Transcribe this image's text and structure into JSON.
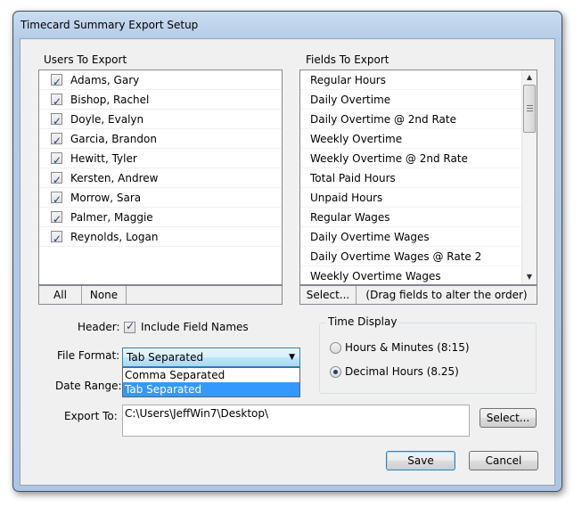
{
  "window": {
    "title": "Timecard Summary Export Setup"
  },
  "users": {
    "heading": "Users To Export",
    "items": [
      {
        "name": "Adams, Gary",
        "checked": true
      },
      {
        "name": "Bishop, Rachel",
        "checked": true
      },
      {
        "name": "Doyle, Evalyn",
        "checked": true
      },
      {
        "name": "Garcia, Brandon",
        "checked": true
      },
      {
        "name": "Hewitt, Tyler",
        "checked": true
      },
      {
        "name": "Kersten, Andrew",
        "checked": true
      },
      {
        "name": "Morrow, Sara",
        "checked": true
      },
      {
        "name": "Palmer, Maggie",
        "checked": true
      },
      {
        "name": "Reynolds, Logan",
        "checked": true
      }
    ],
    "all_label": "All",
    "none_label": "None"
  },
  "fields": {
    "heading": "Fields To Export",
    "items": [
      "Regular Hours",
      "Daily Overtime",
      "Daily Overtime @ 2nd Rate",
      "Weekly Overtime",
      "Weekly Overtime @ 2nd Rate",
      "Total Paid Hours",
      "Unpaid Hours",
      "Regular Wages",
      "Daily Overtime Wages",
      "Daily Overtime Wages @ Rate 2",
      "Weekly Overtime Wages"
    ],
    "select_label": "Select...",
    "hint": "(Drag fields to alter the order)"
  },
  "header": {
    "label": "Header:",
    "checkbox_label": "Include Field Names",
    "checked": true
  },
  "file_format": {
    "label": "File Format:",
    "selected": "Tab Separated",
    "options": [
      "Comma Separated",
      "Tab Separated"
    ]
  },
  "date_range": {
    "label": "Date Range:"
  },
  "export_to": {
    "label": "Export To:",
    "value": "C:\\Users\\JeffWin7\\Desktop\\",
    "select_label": "Select..."
  },
  "time_display": {
    "heading": "Time Display",
    "option1": "Hours & Minutes  (8:15)",
    "option2": "Decimal Hours  (8.25)",
    "selected": "option2"
  },
  "buttons": {
    "save": "Save",
    "cancel": "Cancel"
  },
  "icons": {
    "check": "✓",
    "scroll_up": "▲",
    "scroll_down": "▼",
    "combo_arrow": "▼"
  }
}
